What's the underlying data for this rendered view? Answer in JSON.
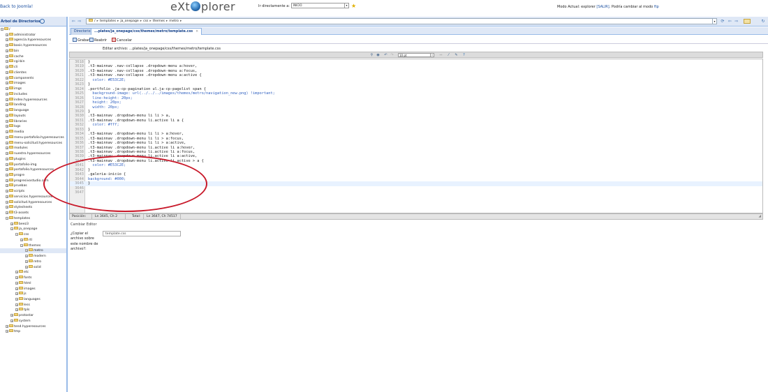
{
  "header": {
    "back_link": "Back to Joomla!",
    "logo_left": "eXt",
    "logo_right": "plorer",
    "goto_label": "Ir directamente a:",
    "goto_value": "INICIO",
    "mode_prefix": "Modo Actual: explorer",
    "mode_exit": "[SALIR]",
    "mode_middle": ". Podría cambiar al modo",
    "mode_ftp": "ftp"
  },
  "sidebar": {
    "title": "Árbol de Directorios",
    "root": "/",
    "items": [
      {
        "label": "administrator",
        "level": 1
      },
      {
        "label": "agencia.hyperesources",
        "level": 1
      },
      {
        "label": "basic.hyperesources",
        "level": 1
      },
      {
        "label": "bin",
        "level": 1
      },
      {
        "label": "cache",
        "level": 1
      },
      {
        "label": "cgi-bin",
        "level": 1
      },
      {
        "label": "cli",
        "level": 1
      },
      {
        "label": "clientes",
        "level": 1
      },
      {
        "label": "components",
        "level": 1
      },
      {
        "label": "images",
        "level": 1
      },
      {
        "label": "imgs",
        "level": 1
      },
      {
        "label": "includes",
        "level": 1
      },
      {
        "label": "index.hyperesources",
        "level": 1
      },
      {
        "label": "landing",
        "level": 1
      },
      {
        "label": "language",
        "level": 1
      },
      {
        "label": "layouts",
        "level": 1
      },
      {
        "label": "libraries",
        "level": 1
      },
      {
        "label": "logs",
        "level": 1
      },
      {
        "label": "media",
        "level": 1
      },
      {
        "label": "menu-portafolio.hyperesources",
        "level": 1
      },
      {
        "label": "menu-solicitud.hyperesources",
        "level": 1
      },
      {
        "label": "modules",
        "level": 1
      },
      {
        "label": "nuestro.hyperesources",
        "level": 1
      },
      {
        "label": "plugins",
        "level": 1
      },
      {
        "label": "portafolio-img",
        "level": 1
      },
      {
        "label": "portafolio.hyperesources",
        "level": 1
      },
      {
        "label": "progre",
        "level": 1
      },
      {
        "label": "progresivostudio.com",
        "level": 1
      },
      {
        "label": "pruebas",
        "level": 1
      },
      {
        "label": "scripts",
        "level": 1
      },
      {
        "label": "servicios.hyperesources",
        "level": 1
      },
      {
        "label": "solicitud.hyperesources",
        "level": 1
      },
      {
        "label": "stylesheets",
        "level": 1
      },
      {
        "label": "t3-assets",
        "level": 1
      },
      {
        "label": "templates",
        "level": 1
      },
      {
        "label": "beez3",
        "level": 2
      },
      {
        "label": "ja_onepage",
        "level": 2
      },
      {
        "label": "css",
        "level": 3
      },
      {
        "label": "rtl",
        "level": 4
      },
      {
        "label": "themes",
        "level": 4
      },
      {
        "label": "metro",
        "level": 5,
        "selected": true
      },
      {
        "label": "modern",
        "level": 5
      },
      {
        "label": "retro",
        "level": 5
      },
      {
        "label": "solid",
        "level": 5
      },
      {
        "label": "etc",
        "level": 3
      },
      {
        "label": "fonts",
        "level": 3
      },
      {
        "label": "html",
        "level": 3
      },
      {
        "label": "images",
        "level": 3
      },
      {
        "label": "js",
        "level": 3
      },
      {
        "label": "languages",
        "level": 3
      },
      {
        "label": "less",
        "level": 3
      },
      {
        "label": "tpls",
        "level": 3
      },
      {
        "label": "protostar",
        "level": 2
      },
      {
        "label": "system",
        "level": 2
      },
      {
        "label": "tend.hyperesources",
        "level": 1
      },
      {
        "label": "tmp",
        "level": 1
      }
    ]
  },
  "breadcrumb": {
    "items": [
      "/",
      "templates",
      "ja_onepage",
      "css",
      "themes",
      "metro"
    ]
  },
  "tabs": [
    {
      "label": "Directorio",
      "active": false
    },
    {
      "label": "...plates/ja_onepage/css/themes/metro/template.css",
      "active": true
    }
  ],
  "panel": {
    "save": "Grabar",
    "reopen": "Reabrir",
    "cancel": "Cancelar",
    "edit_title": "Editar archivo: ...plates/ja_onepage/css/themes/metro/template.css",
    "font_size": "10 pt"
  },
  "code_lines": [
    {
      "n": "3618",
      "t": "}"
    },
    {
      "n": "3619",
      "t": ".t3-mainnav .nav-collapse .dropdown-menu a:hover,"
    },
    {
      "n": "3620",
      "t": ".t3-mainnav .nav-collapse .dropdown-menu a:focus,"
    },
    {
      "n": "3621",
      "t": ".t3-mainnav .nav-collapse .dropdown-menu a:active {"
    },
    {
      "n": "3622",
      "t": "  color: #E53C2E;"
    },
    {
      "n": "3623",
      "t": "}"
    },
    {
      "n": "3624",
      "t": ".portfolio .ja-cp-pagination ul.ja-cp-pagelist span {"
    },
    {
      "n": "3625",
      "t": "  background-image: url(../../../images/themes/metro/navigation_new.png) !important;"
    },
    {
      "n": "3626",
      "t": "  line-height: 20px;"
    },
    {
      "n": "3627",
      "t": "  height: 20px;"
    },
    {
      "n": "3628",
      "t": "  width: 20px;"
    },
    {
      "n": "3629",
      "t": "}"
    },
    {
      "n": "3630",
      "t": ".t3-mainnav .dropdown-menu li li > a,"
    },
    {
      "n": "3631",
      "t": ".t3-mainnav .dropdown-menu li.active li a {"
    },
    {
      "n": "3632",
      "t": "  color: #fff;"
    },
    {
      "n": "3633",
      "t": "}"
    },
    {
      "n": "3634",
      "t": ".t3-mainnav .dropdown-menu li li > a:hover,"
    },
    {
      "n": "3635",
      "t": ".t3-mainnav .dropdown-menu li li > a:focus,"
    },
    {
      "n": "3636",
      "t": ".t3-mainnav .dropdown-menu li li > a:active,"
    },
    {
      "n": "3637",
      "t": ".t3-mainnav .dropdown-menu li.active li a:hover,"
    },
    {
      "n": "3638",
      "t": ".t3-mainnav .dropdown-menu li.active li a:focus,"
    },
    {
      "n": "3639",
      "t": ".t3-mainnav .dropdown-menu li.active li a:active,"
    },
    {
      "n": "3640",
      "t": ".t3-mainnav .dropdown-menu li.active li.active > a {"
    },
    {
      "n": "3641",
      "t": "  color: #E53C2E;"
    },
    {
      "n": "3642",
      "t": "}"
    },
    {
      "n": "3643",
      "t": ".galeria-inicio {"
    },
    {
      "n": "3644",
      "t": "background: #000;"
    },
    {
      "n": "3645",
      "t": "}"
    },
    {
      "n": "3646",
      "t": ""
    },
    {
      "n": "3647",
      "t": ""
    }
  ],
  "current_line": "3645",
  "status": {
    "position_label": "Posición:",
    "position_value": "Ln 3645, Ch 2",
    "total_label": "Total:",
    "total_value": "Ln 3647, Ch 74517"
  },
  "rename": {
    "title": "Cambiar Editor",
    "question": "¿Copiar el archivo sobre este nombre de archivo?:",
    "filename": "template.css"
  },
  "colors": {
    "accent": "#15428b",
    "annotation": "#c8192a",
    "css_value": "#c03050"
  }
}
